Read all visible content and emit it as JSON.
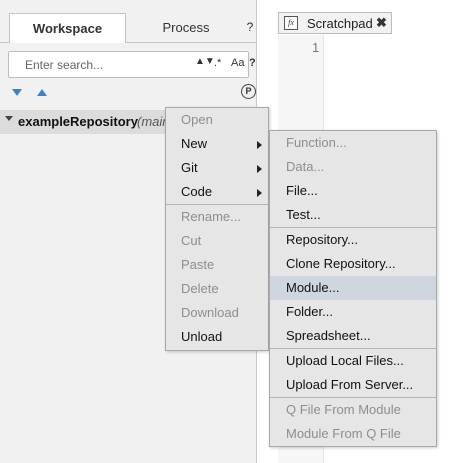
{
  "left_panel": {
    "tabs": {
      "workspace": "Workspace",
      "process": "Process",
      "help": "?"
    },
    "search": {
      "placeholder": "Enter search...",
      "sort_glyph": "▲▼",
      "regex_glyph": ".*",
      "case_glyph": "Aa",
      "help_glyph": "?"
    },
    "badge": "P",
    "tree": {
      "repo_name": "exampleRepository",
      "branch": "(main"
    }
  },
  "editor": {
    "tab_label": "Scratchpad",
    "fx_glyph": "fx",
    "close_glyph": "✖",
    "line_number": "1"
  },
  "context_menu": {
    "items": [
      {
        "label": "Open",
        "disabled": true
      },
      {
        "label": "New",
        "disabled": false,
        "submenu": true
      },
      {
        "label": "Git",
        "disabled": false,
        "submenu": true
      },
      {
        "label": "Code",
        "disabled": false,
        "submenu": true
      },
      {
        "label": "Rename...",
        "disabled": true
      },
      {
        "label": "Cut",
        "disabled": true
      },
      {
        "label": "Paste",
        "disabled": true
      },
      {
        "label": "Delete",
        "disabled": true
      },
      {
        "label": "Download",
        "disabled": true
      },
      {
        "label": "Unload",
        "disabled": false
      }
    ]
  },
  "submenu": {
    "items": [
      {
        "label": "Function...",
        "disabled": true
      },
      {
        "label": "Data...",
        "disabled": true
      },
      {
        "label": "File...",
        "disabled": false
      },
      {
        "label": "Test...",
        "disabled": false
      },
      {
        "label": "Repository...",
        "disabled": false
      },
      {
        "label": "Clone Repository...",
        "disabled": false
      },
      {
        "label": "Module...",
        "disabled": false,
        "highlighted": true
      },
      {
        "label": "Folder...",
        "disabled": false
      },
      {
        "label": "Spreadsheet...",
        "disabled": false
      },
      {
        "label": "Upload Local Files...",
        "disabled": false
      },
      {
        "label": "Upload From Server...",
        "disabled": false
      },
      {
        "label": "Q File From Module",
        "disabled": true
      },
      {
        "label": "Module From Q File",
        "disabled": true
      }
    ]
  },
  "colors": {
    "accent_arrow": "#3a84c9",
    "highlight": "#cfd6df",
    "menu_bg": "#e6e6e6",
    "disabled_text": "#8e8e8e"
  }
}
